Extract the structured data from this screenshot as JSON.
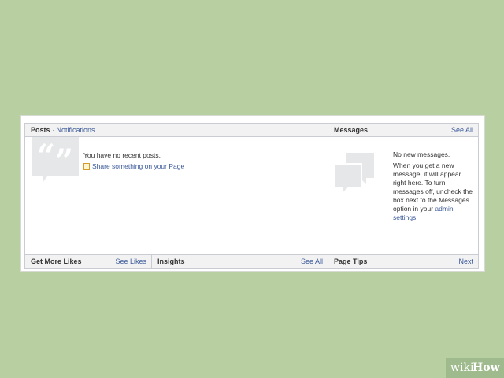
{
  "posts": {
    "title": "Posts",
    "separator": " · ",
    "notifications_link": "Notifications",
    "empty_text": "You have no recent posts.",
    "share_link": "Share something on your Page"
  },
  "messages": {
    "title": "Messages",
    "see_all": "See All",
    "no_new": "No new messages.",
    "help_lines": [
      "When you get a new",
      "message, it will appear",
      "right here. To turn",
      "messages off, uncheck the",
      "box next to the Messages",
      "option in your "
    ],
    "admin_link_1": "admin",
    "admin_link_2": "settings."
  },
  "get_more_likes": {
    "title": "Get More Likes",
    "see_likes": "See Likes"
  },
  "insights": {
    "title": "Insights",
    "see_all": "See All"
  },
  "page_tips": {
    "title": "Page Tips",
    "next": "Next"
  },
  "watermark": {
    "wiki": "wiki",
    "how": "How"
  },
  "colors": {
    "background": "#b8cfa2",
    "link": "#3b5998",
    "header_bg": "#f2f2f2"
  }
}
